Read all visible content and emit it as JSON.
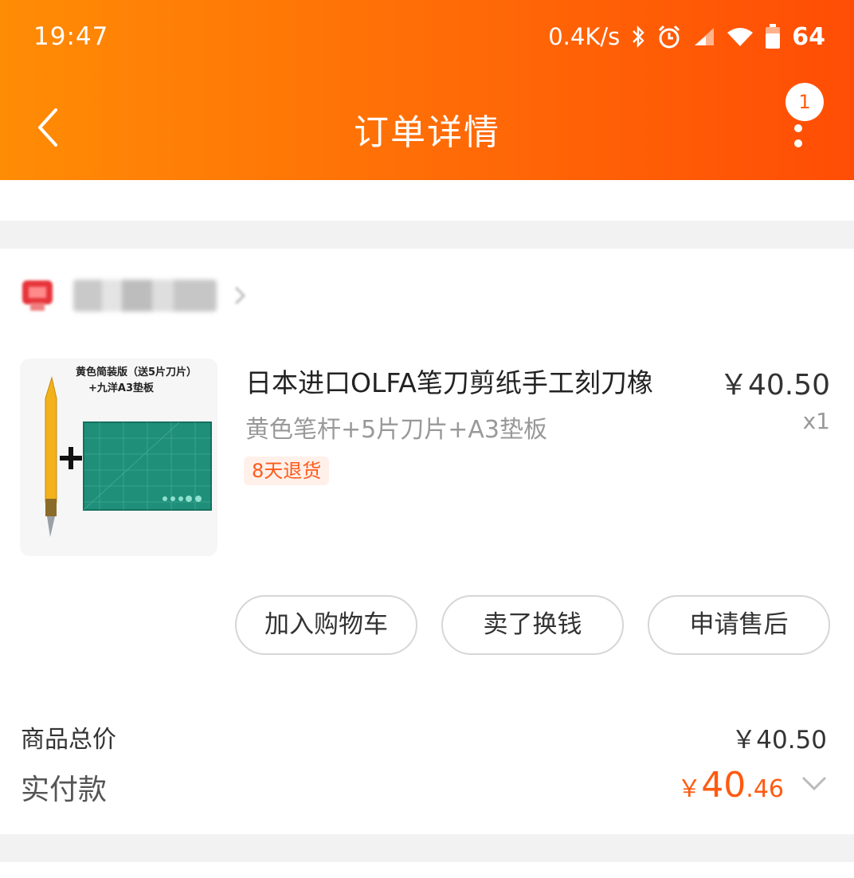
{
  "status_bar": {
    "time": "19:47",
    "network_speed": "0.4K/s",
    "battery": "64",
    "icons": [
      "bluetooth-icon",
      "alarm-icon",
      "signal-icon",
      "wifi-icon",
      "battery-icon"
    ]
  },
  "header": {
    "title": "订单详情",
    "badge_count": "1",
    "back_icon": "chevron-left-icon",
    "more_icon": "more-vertical-icon",
    "color_start": "#ff8c05",
    "color_end": "#ff4d05"
  },
  "product": {
    "image_caption_line1": "黄色简装版（送5片刀片）",
    "image_caption_line2": "+九洋A3垫板",
    "title": "日本进口OLFA笔刀剪纸手工刻刀橡",
    "price": "￥40.50",
    "spec": "黄色笔杆+5片刀片+A3垫板",
    "quantity": "x1",
    "return_policy": "8天退货"
  },
  "actions": {
    "add_to_cart": "加入购物车",
    "resell": "卖了换钱",
    "after_sales": "申请售后"
  },
  "summary": {
    "goods_total_label": "商品总价",
    "goods_total_value": "￥40.50",
    "paid_label": "实付款",
    "paid_currency": "￥",
    "paid_integer": "40",
    "paid_decimal": ".46"
  },
  "accent_color": "#ff5a10"
}
